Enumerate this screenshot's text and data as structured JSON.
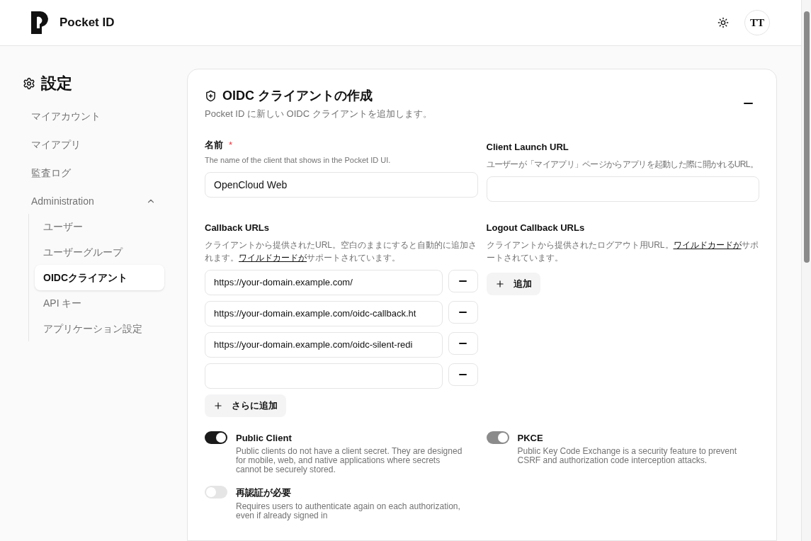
{
  "header": {
    "app_name": "Pocket ID",
    "avatar": "TT"
  },
  "sidebar": {
    "title": "設定",
    "items": [
      {
        "label": "マイアカウント",
        "selected": false
      },
      {
        "label": "マイアプリ",
        "selected": false
      },
      {
        "label": "監査ログ",
        "selected": false
      },
      {
        "label": "Administration",
        "selected": false,
        "expanded": true,
        "children": [
          {
            "label": "ユーザー",
            "selected": false
          },
          {
            "label": "ユーザーグループ",
            "selected": false
          },
          {
            "label": "OIDCクライアント",
            "selected": true
          },
          {
            "label": "API キー",
            "selected": false
          },
          {
            "label": "アプリケーション設定",
            "selected": false
          }
        ]
      }
    ]
  },
  "form": {
    "title": "OIDC クライアントの作成",
    "subtitle": "Pocket ID に新しい OIDC クライアントを追加します。",
    "name_field": {
      "label": "名前",
      "required_mark": "*",
      "hint": "The name of the client that shows in the Pocket ID UI.",
      "value": "OpenCloud Web"
    },
    "launch_url_field": {
      "label": "Client Launch URL",
      "hint": "ユーザーが「マイアプリ」ページからアプリを起動した際に開かれるURL。"
    },
    "callback_urls": {
      "label": "Callback URLs",
      "hint_before": "クライアントから提供されたURL。空白のままにすると自動的に追加されます。",
      "hint_link": "ワイルドカードが",
      "hint_after": "サポートされています。",
      "urls": [
        {
          "kind": "filled",
          "value": "https://your-domain.example.com/"
        },
        {
          "kind": "filled",
          "value": "https://your-domain.example.com/oidc-callback.ht"
        },
        {
          "kind": "filled",
          "value": "https://your-domain.example.com/oidc-silent-redi"
        },
        {
          "kind": "blank"
        }
      ],
      "add_button": "さらに追加"
    },
    "logout_urls": {
      "label": "Logout Callback URLs",
      "hint_before": "クライアントから提供されたログアウト用URL。",
      "hint_link": "ワイルドカードが",
      "hint_after": "サポートされています。",
      "add_button": "追加"
    },
    "toggles": [
      {
        "label": "Public Client",
        "description": "Public clients do not have a client secret. They are designed for mobile, web, and native applications where secrets cannot be securely stored.",
        "on": true,
        "disabled": false
      },
      {
        "label": "PKCE",
        "description": "Public Key Code Exchange is a security feature to prevent CSRF and authorization code interception attacks.",
        "on": true,
        "disabled": true
      },
      {
        "label": "再認証が必要",
        "description": "Requires users to authenticate again on each authorization, even if already signed in",
        "on": false,
        "disabled": false
      }
    ]
  }
}
